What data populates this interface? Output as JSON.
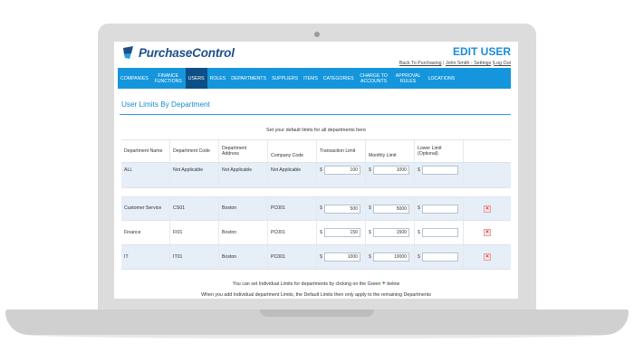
{
  "brand": {
    "name": "PurchaseControl"
  },
  "page": {
    "title": "EDIT USER"
  },
  "user_links": {
    "back": "Back To Purchasing",
    "sep1": " | ",
    "user": "John Smith - Settings",
    "sep2": " |",
    "logout": "Log Out"
  },
  "nav": [
    {
      "label": "COMPANIES",
      "active": false
    },
    {
      "label": "FINANCE FUNCTIONS",
      "active": false
    },
    {
      "label": "USERS",
      "active": true
    },
    {
      "label": "ROLES",
      "active": false
    },
    {
      "label": "DEPARTMENTS",
      "active": false
    },
    {
      "label": "SUPPLIERS",
      "active": false
    },
    {
      "label": "ITEMS",
      "active": false
    },
    {
      "label": "CATEGORIES",
      "active": false
    },
    {
      "label": "CHARGE TO ACCOUNTS",
      "active": false
    },
    {
      "label": "APPROVAL RULES",
      "active": false
    },
    {
      "label": "LOCATIONS",
      "active": false
    }
  ],
  "section": {
    "title": "User Limits By Department",
    "subtitle": "Set your default limits for all departments here"
  },
  "table": {
    "headers": {
      "dept_name": "Department Name",
      "dept_code": "Department Code",
      "dept_address": "Department Address",
      "company_code": "Company Code",
      "transaction_limit": "Transaction Limit",
      "monthly_limit": "Monthly Limit",
      "lower_limit": "Lower Limit (Optional)"
    },
    "currency": "$",
    "default_row": {
      "name": "ALL",
      "code": "Not Applicable",
      "address": "Not Applicable",
      "company": "Not Applicable",
      "transaction": "100",
      "monthly": "1000",
      "lower": ""
    },
    "rows": [
      {
        "name": "Customer Service",
        "code": "CS01",
        "address": "Boston",
        "company": "PC001",
        "transaction": "500",
        "monthly": "5000",
        "lower": ""
      },
      {
        "name": "Finance",
        "code": "FI01",
        "address": "Boston",
        "company": "PC001",
        "transaction": "150",
        "monthly": "1500",
        "lower": ""
      },
      {
        "name": "IT",
        "code": "IT01",
        "address": "Boston",
        "company": "PC001",
        "transaction": "1000",
        "monthly": "10000",
        "lower": ""
      }
    ]
  },
  "footer": {
    "note1_before": "You can set Individual Limits for departments by clicking on the Green",
    "note1_after": "below",
    "note2": "When you add Individual department Limits, the Default Limits then only apply to the remaining Departments"
  },
  "colors": {
    "nav_bg": "#1596dc",
    "nav_active": "#0d4e86",
    "title_blue": "#1c8cd6",
    "row_blue": "#e6eef7"
  }
}
